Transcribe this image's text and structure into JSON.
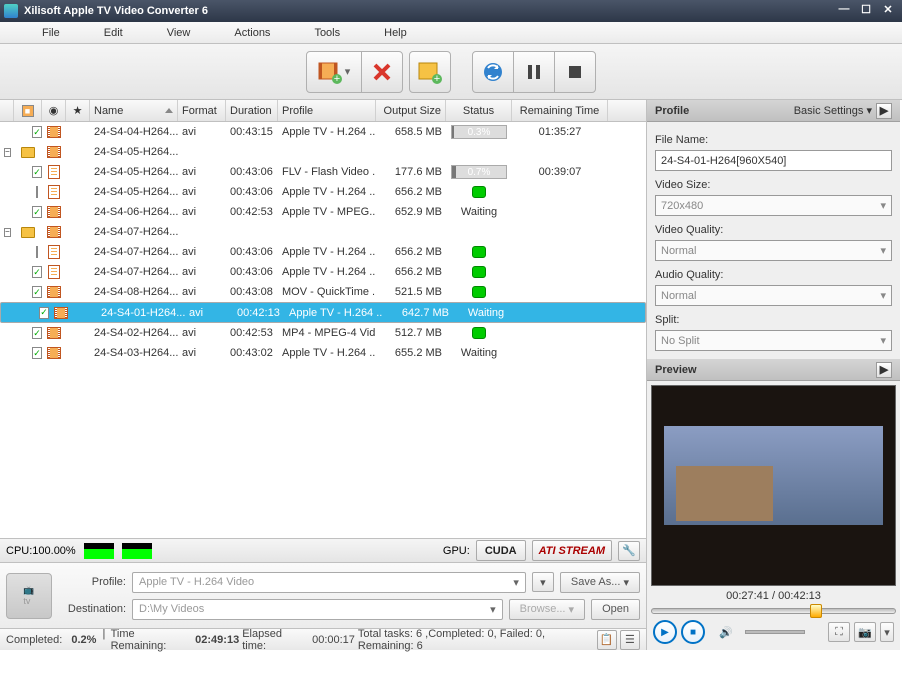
{
  "window": {
    "title": "Xilisoft Apple TV Video Converter 6"
  },
  "menu": [
    "File",
    "Edit",
    "View",
    "Actions",
    "Tools",
    "Help"
  ],
  "columns": {
    "name": "Name",
    "format": "Format",
    "duration": "Duration",
    "profile": "Profile",
    "output_size": "Output Size",
    "status": "Status",
    "remaining": "Remaining Time"
  },
  "rows": [
    {
      "type": "item",
      "indent": 1,
      "checked": true,
      "icon": "film",
      "name": "24-S4-04-H264...",
      "format": "avi",
      "duration": "00:43:15",
      "profile": "Apple TV - H.264 ...",
      "size": "658.5 MB",
      "status_type": "progress",
      "status": "0.3%",
      "remaining": "01:35:27"
    },
    {
      "type": "group",
      "indent": 0,
      "expanded": true,
      "icon": "folder",
      "film": true,
      "name": "24-S4-05-H264..."
    },
    {
      "type": "item",
      "indent": 1,
      "checked": true,
      "icon": "doc",
      "name": "24-S4-05-H264...",
      "format": "avi",
      "duration": "00:43:06",
      "profile": "FLV - Flash Video ...",
      "size": "177.6 MB",
      "status_type": "progress",
      "status": "0.7%",
      "remaining": "00:39:07"
    },
    {
      "type": "item",
      "indent": 1,
      "checked": false,
      "icon": "doc",
      "name": "24-S4-05-H264...",
      "format": "avi",
      "duration": "00:43:06",
      "profile": "Apple TV - H.264 ...",
      "size": "656.2 MB",
      "status_type": "dot",
      "status": "",
      "remaining": ""
    },
    {
      "type": "item",
      "indent": 1,
      "checked": true,
      "icon": "film",
      "name": "24-S4-06-H264...",
      "format": "avi",
      "duration": "00:42:53",
      "profile": "Apple TV - MPEG...",
      "size": "652.9 MB",
      "status_type": "text",
      "status": "Waiting",
      "remaining": ""
    },
    {
      "type": "group",
      "indent": 0,
      "expanded": true,
      "icon": "folder",
      "film": true,
      "name": "24-S4-07-H264..."
    },
    {
      "type": "item",
      "indent": 1,
      "checked": false,
      "icon": "doc",
      "name": "24-S4-07-H264...",
      "format": "avi",
      "duration": "00:43:06",
      "profile": "Apple TV - H.264 ...",
      "size": "656.2 MB",
      "status_type": "dot",
      "status": "",
      "remaining": ""
    },
    {
      "type": "item",
      "indent": 1,
      "checked": true,
      "icon": "doc",
      "name": "24-S4-07-H264...",
      "format": "avi",
      "duration": "00:43:06",
      "profile": "Apple TV - H.264 ...",
      "size": "656.2 MB",
      "status_type": "dot",
      "status": "",
      "remaining": ""
    },
    {
      "type": "item",
      "indent": 1,
      "checked": true,
      "icon": "film",
      "name": "24-S4-08-H264...",
      "format": "avi",
      "duration": "00:43:08",
      "profile": "MOV - QuickTime ...",
      "size": "521.5 MB",
      "status_type": "dot",
      "status": "",
      "remaining": ""
    },
    {
      "type": "item",
      "indent": 1,
      "checked": true,
      "selected": true,
      "icon": "film",
      "name": "24-S4-01-H264...",
      "format": "avi",
      "duration": "00:42:13",
      "profile": "Apple TV - H.264 ...",
      "size": "642.7 MB",
      "status_type": "text",
      "status": "Waiting",
      "remaining": ""
    },
    {
      "type": "item",
      "indent": 1,
      "checked": true,
      "icon": "film",
      "name": "24-S4-02-H264...",
      "format": "avi",
      "duration": "00:42:53",
      "profile": "MP4 - MPEG-4 Vid...",
      "size": "512.7 MB",
      "status_type": "dot",
      "status": "",
      "remaining": ""
    },
    {
      "type": "item",
      "indent": 1,
      "checked": true,
      "icon": "film",
      "name": "24-S4-03-H264...",
      "format": "avi",
      "duration": "00:43:02",
      "profile": "Apple TV - H.264 ...",
      "size": "655.2 MB",
      "status_type": "text",
      "status": "Waiting",
      "remaining": ""
    }
  ],
  "perf": {
    "cpu_label": "CPU:100.00%",
    "gpu_label": "GPU:",
    "cuda": "CUDA",
    "ati": "ATI STREAM"
  },
  "config": {
    "profile_label": "Profile:",
    "profile_value": "Apple TV - H.264 Video",
    "dest_label": "Destination:",
    "dest_value": "D:\\My Videos",
    "saveas": "Save As...",
    "browse": "Browse...",
    "open": "Open"
  },
  "status": {
    "completed_lbl": "Completed:",
    "completed_val": "0.2%",
    "time_rem_lbl": "Time Remaining:",
    "time_rem_val": "02:49:13",
    "elapsed_lbl": "Elapsed time:",
    "elapsed_val": "00:00:17",
    "tasks": "Total tasks: 6 ,Completed: 0, Failed: 0, Remaining: 6"
  },
  "profile_panel": {
    "header": "Profile",
    "settings": "Basic Settings",
    "filename_lbl": "File Name:",
    "filename_val": "24-S4-01-H264[960X540]",
    "videosize_lbl": "Video Size:",
    "videosize_val": "720x480",
    "vquality_lbl": "Video Quality:",
    "vquality_val": "Normal",
    "aquality_lbl": "Audio Quality:",
    "aquality_val": "Normal",
    "split_lbl": "Split:",
    "split_val": "No Split"
  },
  "preview": {
    "header": "Preview",
    "time": "00:27:41 / 00:42:13",
    "seek_pct": 65
  }
}
